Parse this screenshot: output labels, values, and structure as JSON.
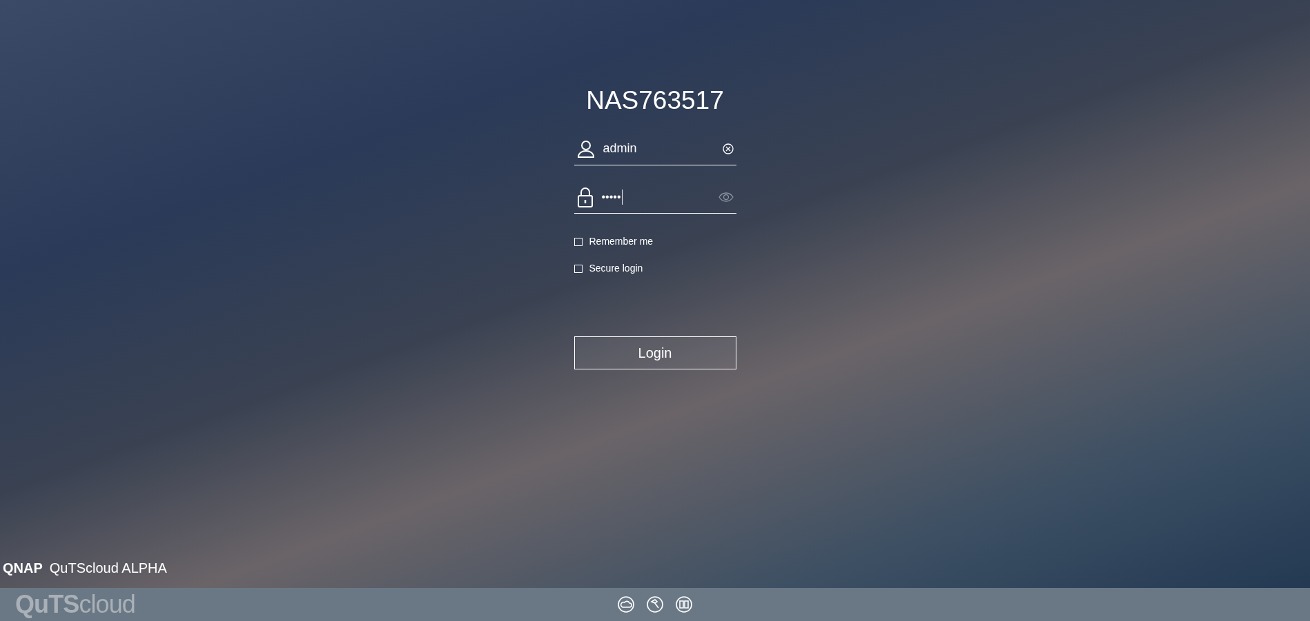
{
  "device_name": "NAS763517",
  "username": {
    "value": "admin"
  },
  "password": {
    "value": "•••••"
  },
  "options": [
    {
      "label": "Remember me",
      "checked": false
    },
    {
      "label": "Secure login",
      "checked": false
    }
  ],
  "login_button": "Login",
  "brand": {
    "company": "QNAP",
    "product": "QuTScloud ALPHA"
  },
  "footer": {
    "logo": "**QuTS**cloud"
  }
}
